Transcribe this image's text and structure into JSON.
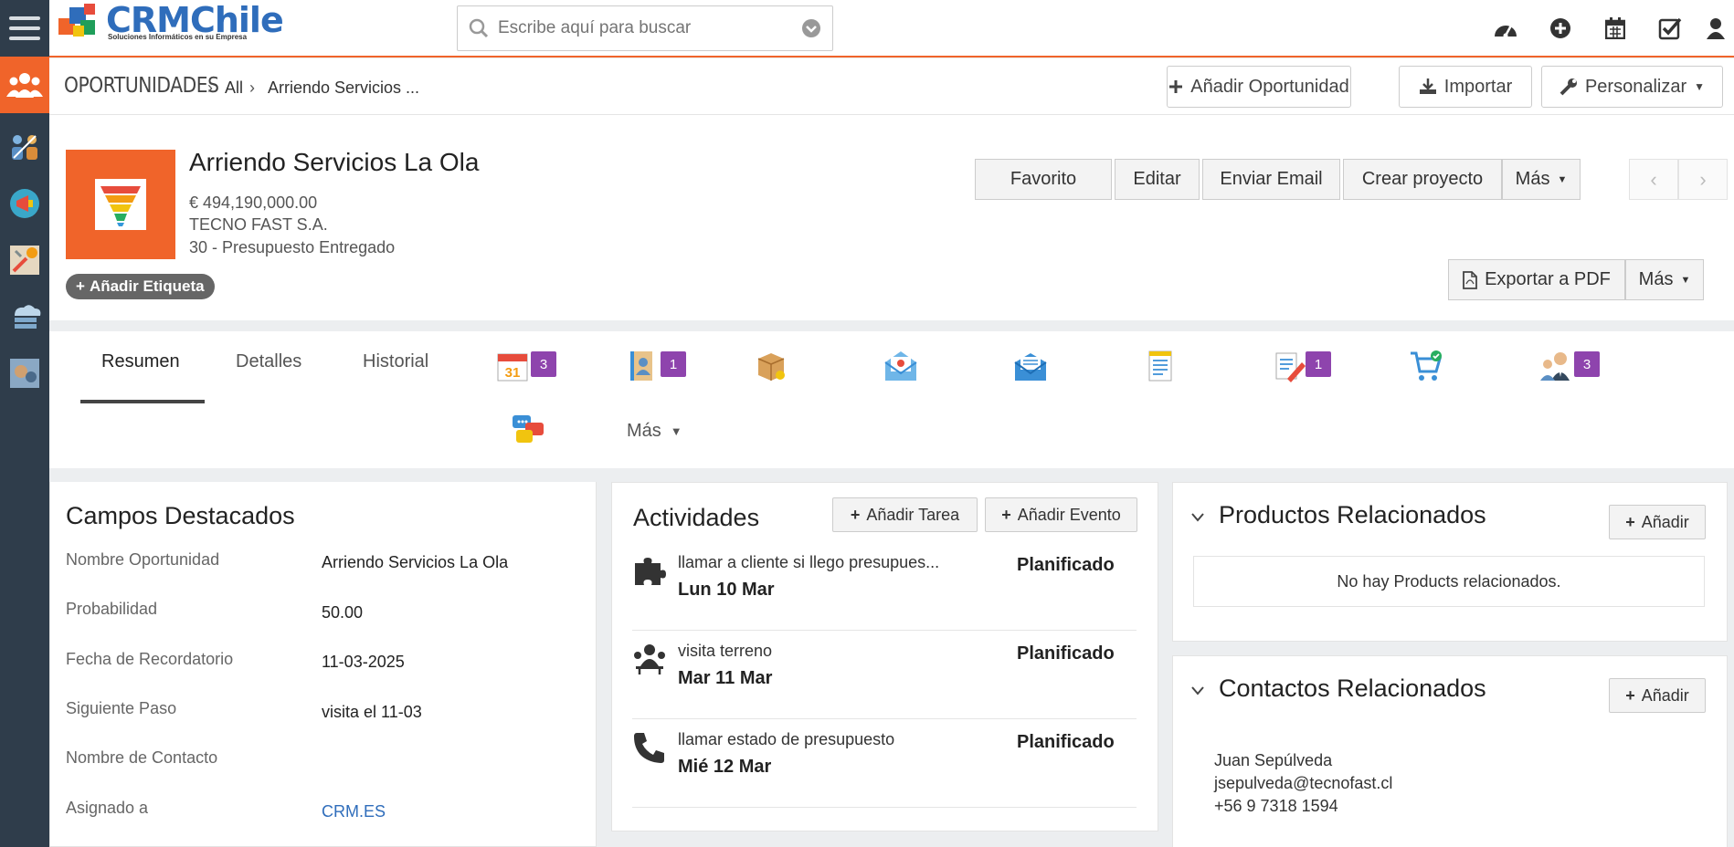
{
  "topbar": {
    "logo_text": "CRMChile",
    "logo_subtitle": "Soluciones Informáticos en su Empresa",
    "search_placeholder": "Escribe aquí para buscar"
  },
  "breadcrumb": {
    "module": "OPORTUNIDADES",
    "filter": "All",
    "record": "Arriendo Servicios ..."
  },
  "header_buttons": {
    "add": "Añadir Oportunidad",
    "import": "Importar",
    "customize": "Personalizar"
  },
  "record": {
    "title": "Arriendo Servicios La Ola",
    "amount": "€ 494,190,000.00",
    "account": "TECNO FAST S.A.",
    "stage": "30 - Presupuesto Entregado",
    "tag_button": "Añadir Etiqueta",
    "actions": {
      "favorite": "Favorito",
      "edit": "Editar",
      "email": "Enviar Email",
      "project": "Crear proyecto",
      "more": "Más",
      "export_pdf": "Exportar a PDF",
      "more2": "Más"
    }
  },
  "tabs": {
    "summary": "Resumen",
    "details": "Detalles",
    "history": "Historial",
    "more": "Más",
    "badges": {
      "calendar": "3",
      "contacts": "1",
      "documents": "1",
      "users": "3"
    }
  },
  "featured": {
    "title": "Campos Destacados",
    "fields": [
      {
        "label": "Nombre Oportunidad",
        "value": "Arriendo Servicios La Ola"
      },
      {
        "label": "Probabilidad",
        "value": "50.00"
      },
      {
        "label": "Fecha de Recordatorio",
        "value": "11-03-2025"
      },
      {
        "label": "Siguiente Paso",
        "value": "visita el 11-03"
      },
      {
        "label": "Nombre de Contacto",
        "value": ""
      },
      {
        "label": "Asignado a",
        "value": "CRM.ES"
      }
    ]
  },
  "activities": {
    "title": "Actividades",
    "add_task": "Añadir Tarea",
    "add_event": "Añadir Evento",
    "items": [
      {
        "name": "llamar a cliente si llego presupues...",
        "date": "Lun 10 Mar",
        "status": "Planificado",
        "icon": "puzzle-icon"
      },
      {
        "name": "visita terreno",
        "date": "Mar 11 Mar",
        "status": "Planificado",
        "icon": "meeting-icon"
      },
      {
        "name": "llamar estado de presupuesto",
        "date": "Mié 12 Mar",
        "status": "Planificado",
        "icon": "phone-icon"
      }
    ]
  },
  "products": {
    "title": "Productos Relacionados",
    "add": "Añadir",
    "empty": "No hay Products relacionados."
  },
  "contacts": {
    "title": "Contactos Relacionados",
    "add": "Añadir",
    "name": "Juan Sepúlveda",
    "email": "jsepulveda@tecnofast.cl",
    "phone": "+56 9 7318 1594"
  },
  "colors": {
    "accent": "#f0642a",
    "sidebar": "#2f3d4b",
    "badge": "#8e44ad",
    "link": "#2f6dbb"
  }
}
